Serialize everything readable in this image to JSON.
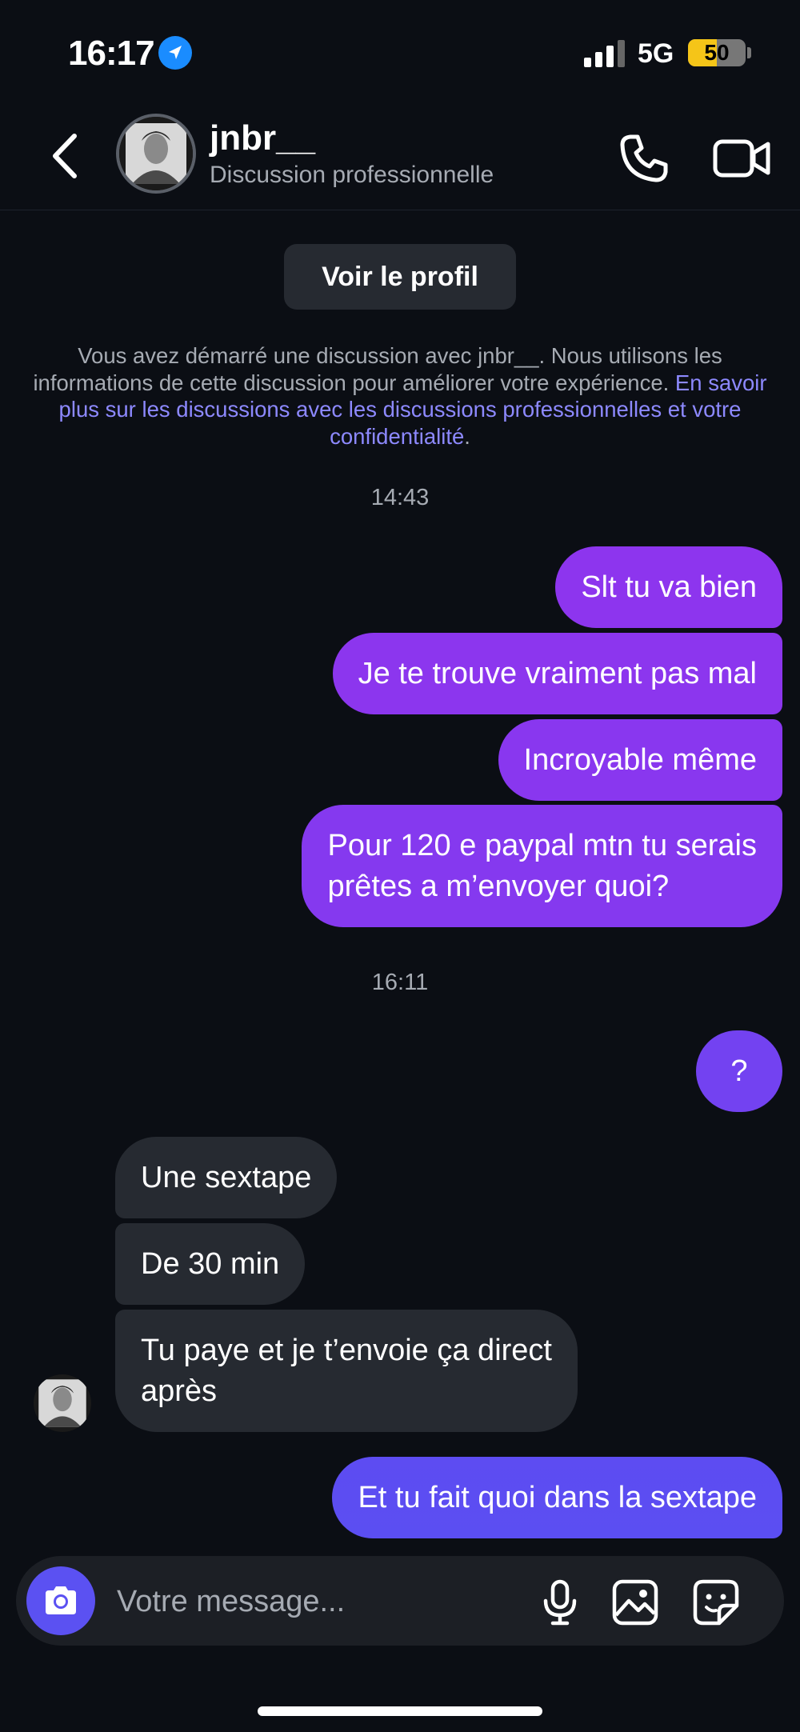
{
  "status_bar": {
    "time": "16:17",
    "network": "5G",
    "battery": "50",
    "battery_level": 0.5
  },
  "header": {
    "username": "jnbr__",
    "subtitle": "Discussion professionnelle"
  },
  "profile_button_label": "Voir le profil",
  "notice": {
    "text": "Vous avez démarré une discussion avec jnbr__. Nous utilisons les informations de cette discussion pour améliorer votre expérience. ",
    "link": "En savoir plus sur les discussions avec les discussions professionnelles et votre confidentialité",
    "end": "."
  },
  "timestamps": [
    "14:43",
    "16:11"
  ],
  "messages": [
    {
      "from": "me",
      "text": "Slt tu va bien"
    },
    {
      "from": "me",
      "text": "Je te trouve vraiment pas mal"
    },
    {
      "from": "me",
      "text": "Incroyable même"
    },
    {
      "from": "me",
      "line1": "Pour 120 e paypal mtn tu serais",
      "line2": "prêtes a m’envoyer quoi?"
    },
    {
      "from": "me",
      "text": "?"
    },
    {
      "from": "them",
      "text": "Une sextape"
    },
    {
      "from": "them",
      "text": "De 30 min"
    },
    {
      "from": "them",
      "line1": "Tu paye et je t’envoie ça direct",
      "line2": "après"
    },
    {
      "from": "me",
      "text": "Et tu fait quoi dans la sextape"
    }
  ],
  "composer": {
    "placeholder": "Votre message..."
  },
  "icons": [
    "location-arrow-icon",
    "signal-icon",
    "back-chevron-icon",
    "phone-icon",
    "video-camera-icon",
    "camera-icon",
    "microphone-icon",
    "gallery-icon",
    "sticker-icon"
  ],
  "colors": {
    "background": "#0b0e14",
    "sent_bubble_top": "#8d35ee",
    "sent_bubble_bottom": "#5b4ef2",
    "received_bubble": "#262a31",
    "link": "#8d89ff",
    "battery": "#f5c518",
    "location": "#1a8cff"
  }
}
